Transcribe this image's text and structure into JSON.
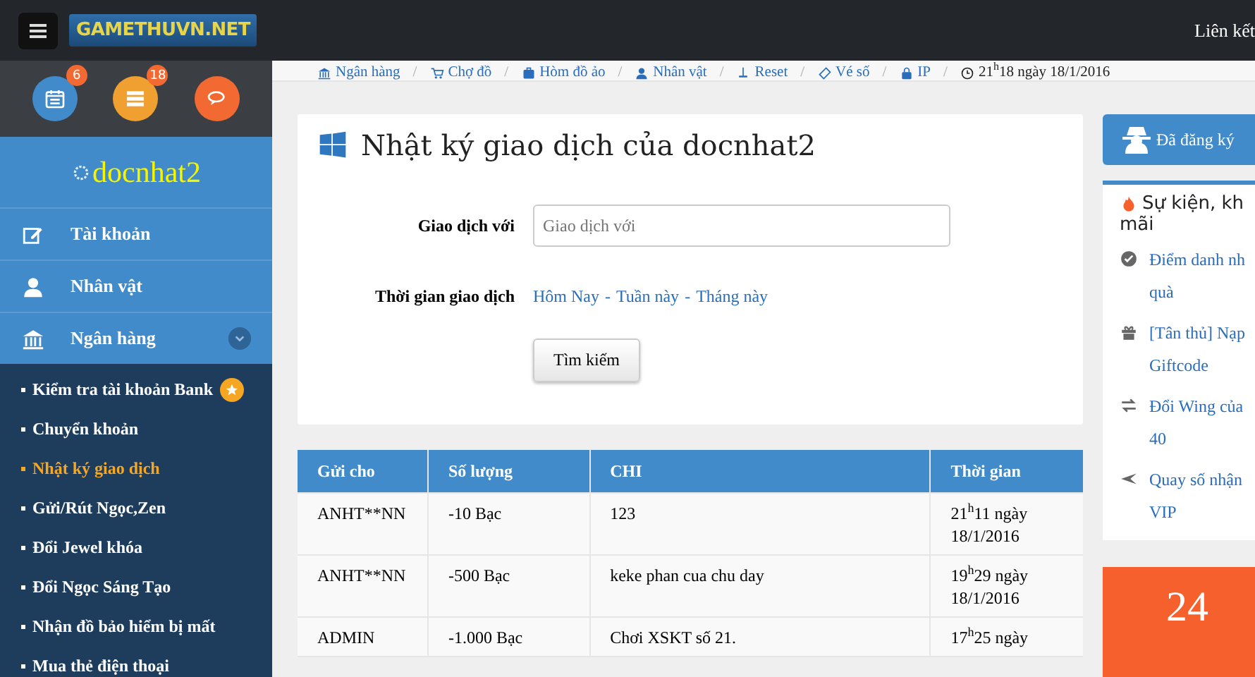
{
  "topbar": {
    "logo": "GAMETHUVN.NET",
    "link": "Liên kết"
  },
  "quick_icons": [
    {
      "kind": "calendar",
      "badge": "6",
      "color": "#428bca"
    },
    {
      "kind": "list",
      "badge": "18",
      "color": "#f0a030"
    },
    {
      "kind": "chat",
      "color": "#f26a32"
    }
  ],
  "user": {
    "name": "docnhat2"
  },
  "nav": [
    {
      "kind": "edit",
      "label": "Tài khoản"
    },
    {
      "kind": "user",
      "label": "Nhân vật"
    },
    {
      "kind": "bank",
      "label": "Ngân hàng",
      "expanded": true,
      "children": [
        {
          "label": "Kiểm tra tài khoản Bank",
          "selected": false,
          "starred": true
        },
        {
          "label": "Chuyển khoản",
          "selected": false,
          "starred": false
        },
        {
          "label": "Nhật ký giao dịch",
          "selected": true,
          "starred": false
        },
        {
          "label": "Gửi/Rút Ngọc,Zen",
          "selected": false,
          "starred": false
        },
        {
          "label": "Đổi Jewel khóa",
          "selected": false,
          "starred": false
        },
        {
          "label": "Đổi Ngọc Sáng Tạo",
          "selected": false,
          "starred": false
        },
        {
          "label": "Nhận đồ bảo hiểm bị mất",
          "selected": false,
          "starred": false
        },
        {
          "label": "Mua thẻ điện thoại",
          "selected": false,
          "starred": false
        }
      ]
    }
  ],
  "breadcrumb": [
    {
      "kind": "bank",
      "label": "Ngân hàng",
      "separator": "/"
    },
    {
      "kind": "cart",
      "label": "Chợ đồ",
      "separator": "/"
    },
    {
      "kind": "case",
      "label": "Hòm đồ ảo",
      "separator": "/"
    },
    {
      "kind": "user",
      "label": "Nhân vật",
      "separator": "/"
    },
    {
      "kind": "reset",
      "label": "Reset",
      "separator": "/"
    },
    {
      "kind": "ticket",
      "label": "Vé số",
      "separator": "/"
    },
    {
      "kind": "lock",
      "label": "IP",
      "separator": "/"
    }
  ],
  "clock": "21$^{h}$18 ngày 18/1/2016",
  "panel": {
    "title": "Nhật ký giao dịch của docnhat2",
    "field_label": "Giao dịch với",
    "field_placeholder": "Giao dịch với",
    "time_label": "Thời gian giao dịch",
    "time_links": [
      {
        "label": "Hôm Nay",
        "separator": "-"
      },
      {
        "label": "Tuần này",
        "separator": "-"
      },
      {
        "label": "Tháng này"
      }
    ],
    "button": "Tìm kiếm"
  },
  "table": {
    "columns": [
      "Gửi cho",
      "Số lượng",
      "CHI",
      "Thời gian"
    ],
    "rows": [
      [
        "ANHT**NN",
        "-10  Bạc",
        "123",
        "21$^{h}$11 ngày 18/1/2016"
      ],
      [
        "ANHT**NN",
        "-500  Bạc",
        "keke phan cua chu day",
        "19$^{h}$29 ngày 18/1/2016"
      ],
      [
        "ADMIN",
        "-1.000  Bạc",
        "Chơi XSKT số 21.",
        "17$^{h}$25 ngày"
      ]
    ]
  },
  "right": {
    "registered": "Đã đăng ký",
    "events_title": [
      "Sự kiện, kh",
      "mãi"
    ],
    "events": [
      {
        "kind": "check",
        "lines": [
          "Điểm danh nh",
          "quà"
        ]
      },
      {
        "kind": "gift",
        "lines": [
          "[Tân thủ] Nạp",
          "Giftcode"
        ]
      },
      {
        "kind": "swap",
        "lines": [
          "Đổi Wing của",
          "40"
        ]
      },
      {
        "kind": "plane",
        "lines": [
          "Quay số nhận",
          "VIP"
        ]
      }
    ],
    "promo": "24"
  }
}
